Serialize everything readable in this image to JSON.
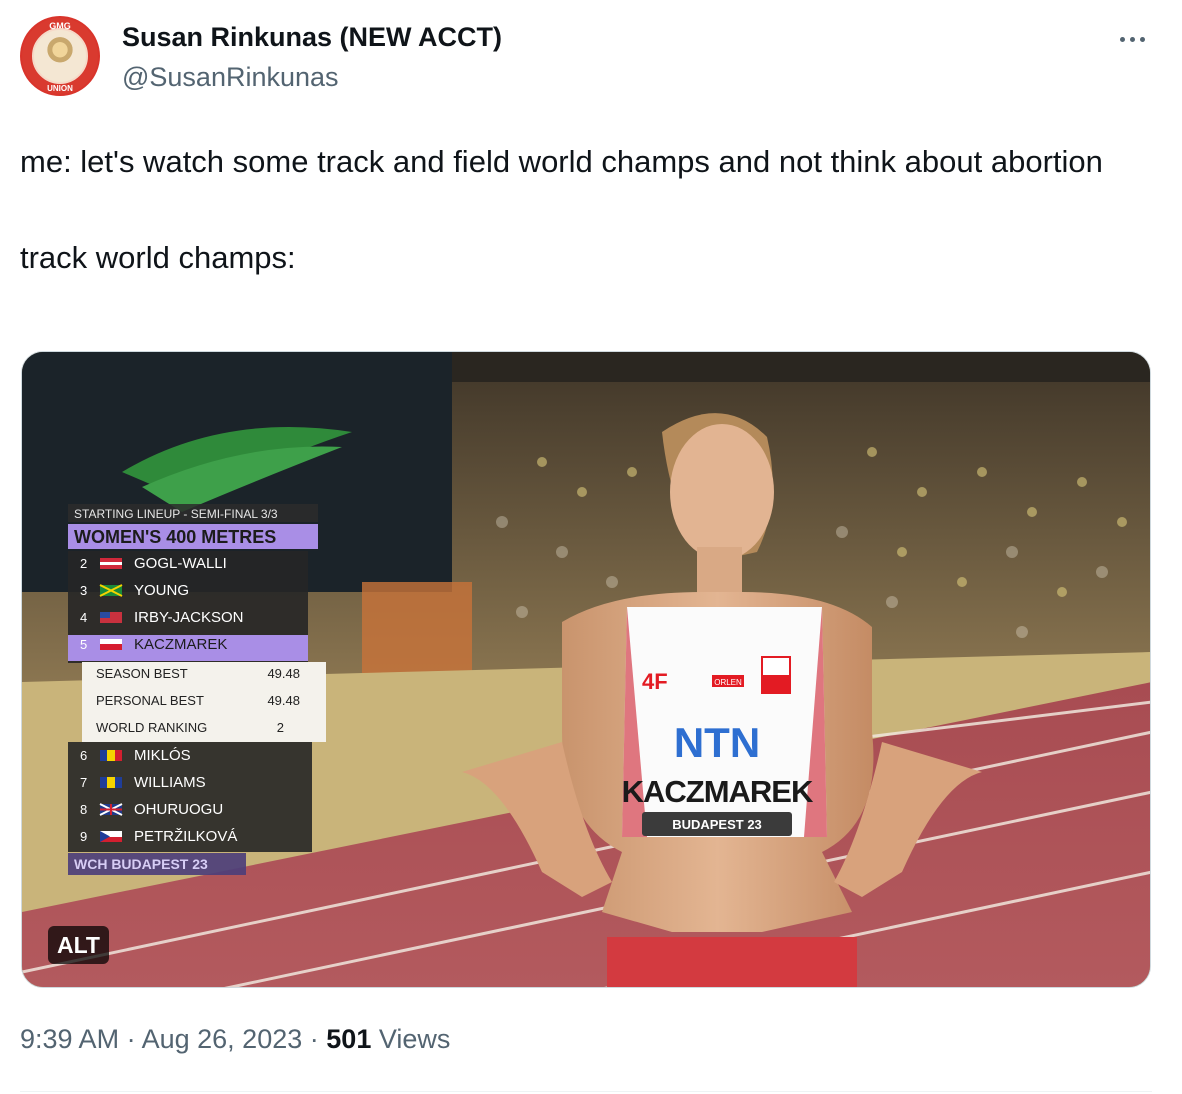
{
  "author": {
    "display_name": "Susan Rinkunas (NEW ACCT)",
    "handle": "@SusanRinkunas",
    "avatar_ring_top": "GMG",
    "avatar_ring_bottom": "UNION"
  },
  "tweet": {
    "text_line_1": "me: let's watch some track and field world champs and not think about abortion",
    "text_line_2": "track world champs:"
  },
  "media": {
    "alt_label": "ALT",
    "graphic": {
      "header": "STARTING LINEUP - SEMI-FINAL 3/3",
      "event": "WOMEN'S 400 METRES",
      "lineup": [
        {
          "lane": "2",
          "name": "GOGL-WALLI"
        },
        {
          "lane": "3",
          "name": "YOUNG"
        },
        {
          "lane": "4",
          "name": "IRBY-JACKSON"
        },
        {
          "lane": "5",
          "name": "KACZMAREK"
        }
      ],
      "stats": [
        {
          "label": "SEASON BEST",
          "value": "49.48"
        },
        {
          "label": "PERSONAL BEST",
          "value": "49.48"
        },
        {
          "label": "WORLD RANKING",
          "value": "2"
        }
      ],
      "lineup_rest": [
        {
          "lane": "6",
          "name": "MIKLÓS"
        },
        {
          "lane": "7",
          "name": "WILLIAMS"
        },
        {
          "lane": "8",
          "name": "OHURUOGU"
        },
        {
          "lane": "9",
          "name": "PETRŽILKOVÁ"
        }
      ],
      "footer": "WCH BUDAPEST 23"
    },
    "bib": {
      "sponsor": "NTN",
      "name": "KACZMAREK",
      "event": "BUDAPEST 23",
      "brand": "4F",
      "partner": "ORLEN"
    }
  },
  "meta": {
    "time": "9:39 AM",
    "separator": "·",
    "date": "Aug 26, 2023",
    "views_count": "501",
    "views_label": "Views"
  },
  "colors": {
    "text_primary": "#0f1419",
    "text_secondary": "#536471",
    "graphic_purple": "#a98ee6",
    "track_red": "#b2545a"
  }
}
